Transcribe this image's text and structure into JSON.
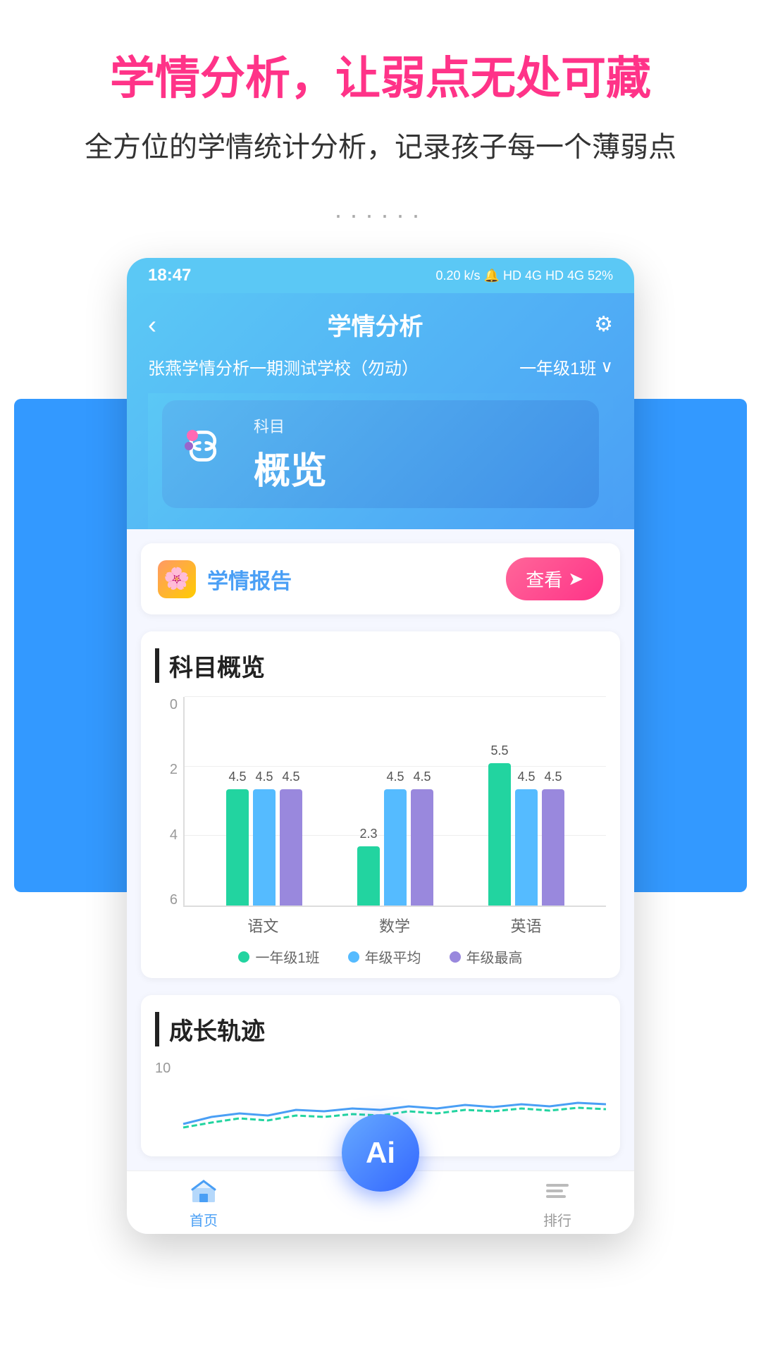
{
  "page": {
    "title": "学情分析，让弱点无处可藏",
    "subtitle": "全方位的学情统计分析，记录孩子每一个薄弱点",
    "dots": "······"
  },
  "statusBar": {
    "time": "18:47",
    "rightIcons": "0.20 k/s  🔔  HD  4G  HD  4G  52%"
  },
  "header": {
    "backIcon": "‹",
    "title": "学情分析",
    "settingsIcon": "⚙"
  },
  "schoolRow": {
    "schoolName": "张燕学情分析一期测试学校（勿动）",
    "classLabel": "一年级1班",
    "chevronIcon": "›"
  },
  "tabCard": {
    "tabLabel": "科目",
    "tabOverview": "概览"
  },
  "reportCard": {
    "iconEmoji": "🌸",
    "title": "学情报告",
    "viewButton": "查看",
    "viewIcon": "⊙"
  },
  "chartSection": {
    "title": "科目概览",
    "yLabels": [
      "0",
      "2",
      "4",
      "6"
    ],
    "maxY": 6,
    "bars": [
      {
        "subject": "语文",
        "values": [
          4.5,
          4.5,
          4.5
        ]
      },
      {
        "subject": "数学",
        "values": [
          2.3,
          4.5,
          4.5
        ]
      },
      {
        "subject": "英语",
        "values": [
          5.5,
          4.5,
          4.5
        ]
      }
    ],
    "legend": [
      {
        "label": "一年级1班",
        "color": "#22d4a0"
      },
      {
        "label": "年级平均",
        "color": "#55bbff"
      },
      {
        "label": "年级最高",
        "color": "#9988dd"
      }
    ]
  },
  "growthSection": {
    "title": "成长轨迹",
    "yMax": "10"
  },
  "bottomNav": {
    "items": [
      {
        "label": "首页",
        "active": true,
        "icon": "home"
      },
      {
        "label": "排行",
        "active": false,
        "icon": "rank"
      }
    ]
  },
  "aiButton": {
    "label": "Ai"
  }
}
